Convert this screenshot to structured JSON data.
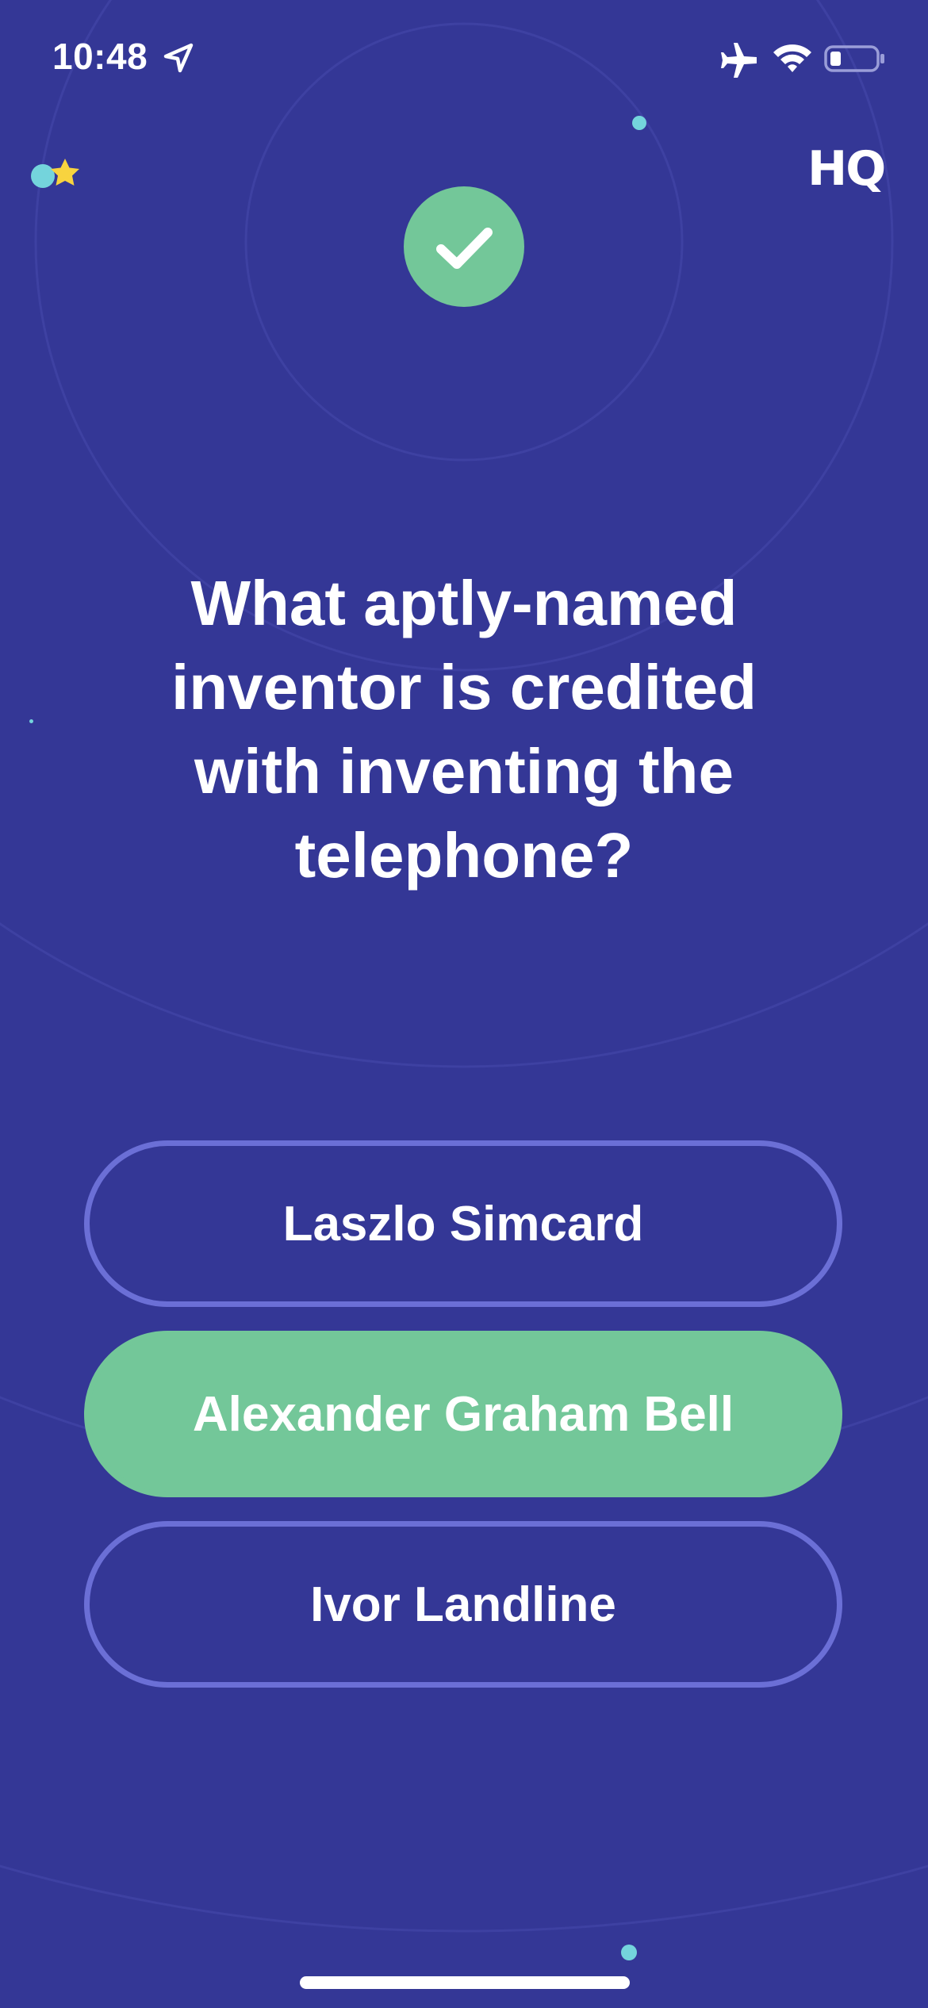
{
  "status_bar": {
    "time": "10:48",
    "icons": [
      "location-arrow-icon",
      "airplane-icon",
      "wifi-icon",
      "battery-low-icon"
    ]
  },
  "header": {
    "logo": "HQ",
    "lives_icon": "star-icon"
  },
  "result": {
    "icon": "checkmark-icon",
    "state": "correct"
  },
  "question": {
    "text": "What aptly-named inventor is credited with inventing the telephone?"
  },
  "answers": [
    {
      "label": "Laszlo Simcard",
      "correct": false
    },
    {
      "label": "Alexander Graham Bell",
      "correct": true
    },
    {
      "label": "Ivor Landline",
      "correct": false
    }
  ],
  "colors": {
    "background": "#343796",
    "correct": "#73c799",
    "answer_border": "#6b6fd6",
    "accent_dot": "#74d4dc",
    "star": "#f8d33f"
  }
}
